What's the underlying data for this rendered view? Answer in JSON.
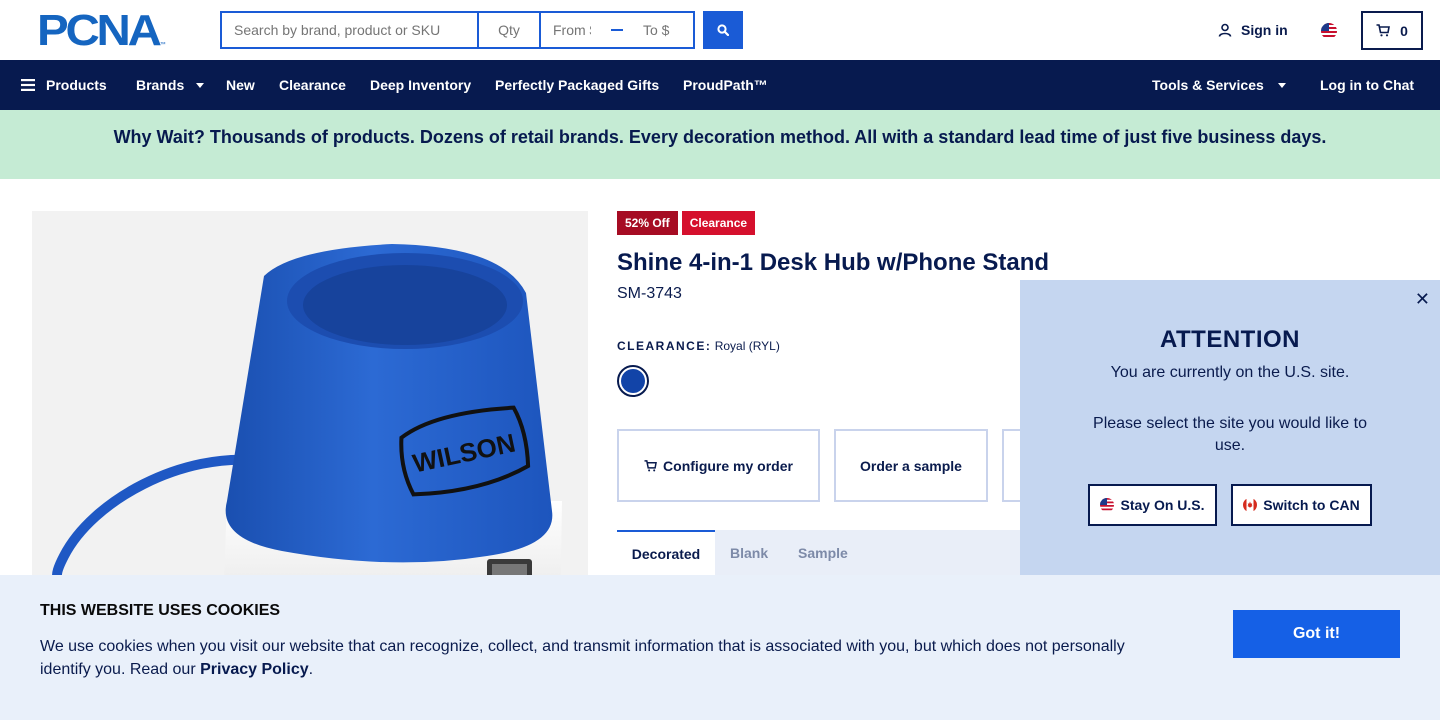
{
  "header": {
    "logo_text": "PCNA",
    "search_placeholder": "Search by brand, product or SKU",
    "qty_placeholder": "Qty",
    "from_placeholder": "From $",
    "to_placeholder": "To $",
    "signin_label": "Sign in",
    "cart_count": "0",
    "accent_color": "#1a5bd6"
  },
  "nav": {
    "products": "Products",
    "brands": "Brands",
    "new": "New",
    "clearance": "Clearance",
    "deep_inventory": "Deep Inventory",
    "gifts": "Perfectly Packaged Gifts",
    "proudpath": "ProudPath™",
    "tools": "Tools & Services",
    "chat": "Log in to Chat",
    "background": "#071a4f"
  },
  "banner": {
    "text": "Why Wait? Thousands of products. Dozens of retail brands. Every decoration method. All with a standard lead time of just five business days.",
    "background": "#c5ebd4"
  },
  "product": {
    "badge_discount": "52% Off",
    "badge_clearance": "Clearance",
    "title": "Shine 4-in-1 Desk Hub w/Phone Stand",
    "sku": "SM-3743",
    "color_label_key": "CLEARANCE:",
    "color_label_value": "Royal (RYL)",
    "swatch_color": "#1244a8",
    "image_logo_text": "WILSON",
    "actions": {
      "configure": "Configure my order",
      "sample": "Order a sample"
    },
    "tabs": [
      "Decorated",
      "Blank",
      "Sample"
    ]
  },
  "attention": {
    "title": "ATTENTION",
    "line1": "You are currently on the U.S. site.",
    "line2": "Please select the site you would like to use.",
    "stay_label": "Stay On U.S.",
    "switch_label": "Switch to CAN",
    "close_symbol": "✕"
  },
  "cookie": {
    "title": "THIS WEBSITE USES COOKIES",
    "text": "We use cookies when you visit our website that can recognize, collect, and transmit information that is associated with you, but which does not personally identify you. Read our ",
    "link": "Privacy Policy",
    "text_end": ".",
    "button": "Got it!"
  }
}
